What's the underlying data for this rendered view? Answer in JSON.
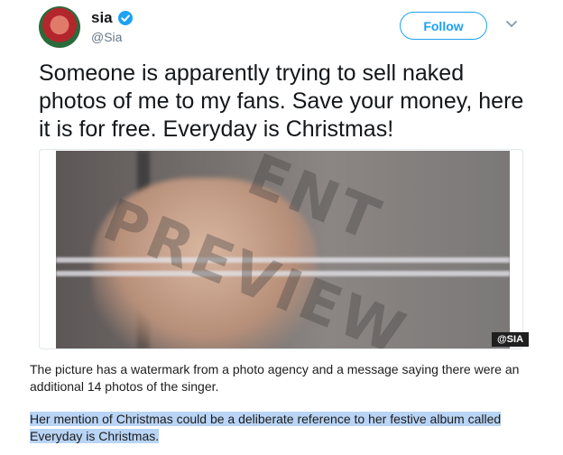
{
  "tweet": {
    "name": "sia",
    "handle": "@Sia",
    "follow_label": "Follow",
    "text": "Someone is apparently trying to sell naked photos of me to my fans. Save your money, here it is for free. Everyday is Christmas!",
    "media": {
      "watermark_word_1": "PREVIEW",
      "watermark_word_2": "ENT",
      "credit": "@SIA"
    },
    "icons": {
      "avatar": "avatar",
      "verified": "verified-badge-icon",
      "more": "chevron-down-icon"
    },
    "colors": {
      "accent": "#1da1f2",
      "text": "#14171a",
      "muted": "#657786"
    }
  },
  "article": {
    "paragraph1": "The picture has a watermark from a photo agency and a message saying there were an additional 14 photos of the singer.",
    "paragraph2": "Her mention of Christmas could be a deliberate reference to her festive album called Everyday is Christmas."
  }
}
